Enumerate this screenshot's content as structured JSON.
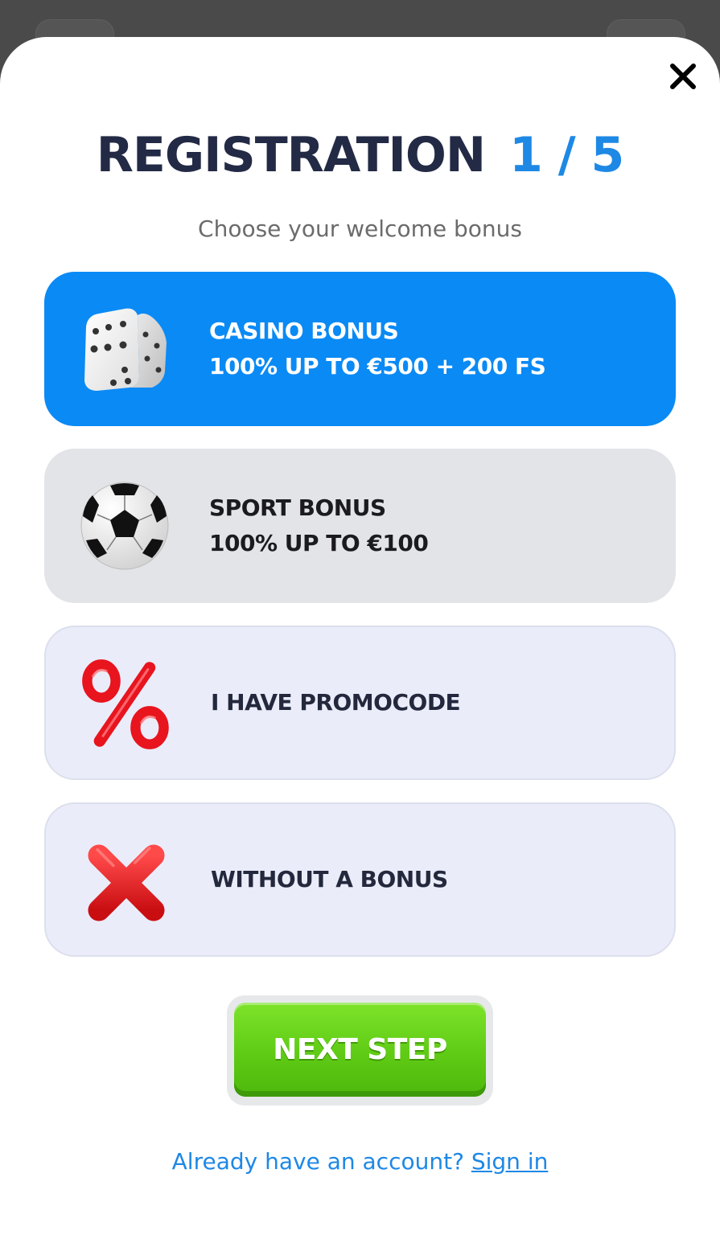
{
  "header": {
    "title": "REGISTRATION",
    "step": "1 / 5",
    "subtitle": "Choose your welcome bonus"
  },
  "options": [
    {
      "icon": "dice-icon",
      "line1": "CASINO BONUS",
      "line2": "100% UP TO €500 + 200 FS",
      "selected": true
    },
    {
      "icon": "soccer-ball-icon",
      "line1": "SPORT BONUS",
      "line2": "100% UP TO €100",
      "selected": false
    },
    {
      "icon": "percent-icon",
      "line1": "I HAVE PROMOCODE",
      "selected": false
    },
    {
      "icon": "red-x-icon",
      "line1": "WITHOUT A BONUS",
      "selected": false
    }
  ],
  "footer": {
    "next_label": "NEXT STEP",
    "account_prompt": "Already have an account?",
    "signin_label": "Sign in"
  },
  "colors": {
    "accent_blue": "#0a8af5",
    "title_dark": "#232a45",
    "next_green": "#5fcb15"
  }
}
